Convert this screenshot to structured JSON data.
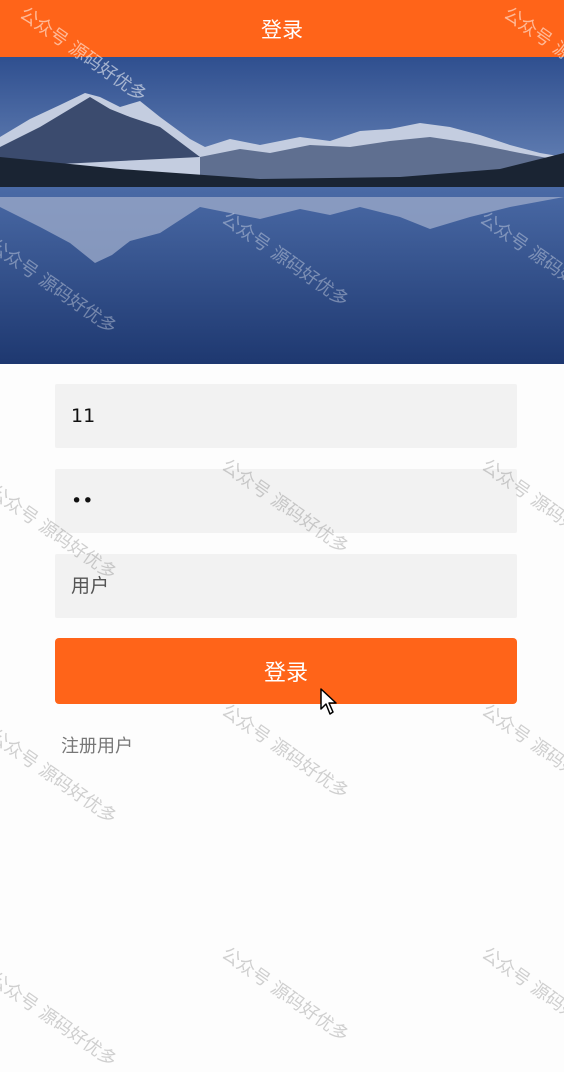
{
  "header": {
    "title": "登录"
  },
  "banner": {
    "alt": "mountain-lake-landscape"
  },
  "form": {
    "username": {
      "value": "11",
      "placeholder": ""
    },
    "password": {
      "value": "11",
      "placeholder": ""
    },
    "user_type": {
      "value": "",
      "placeholder": "用户"
    },
    "login_label": "登录",
    "register_label": "注册用户"
  },
  "watermark": {
    "text": "公众号 源码好优多"
  },
  "colors": {
    "accent": "#ff6419",
    "field_bg": "#f2f2f2",
    "link": "#777777"
  }
}
